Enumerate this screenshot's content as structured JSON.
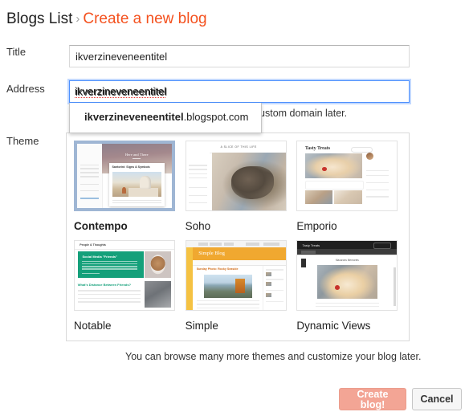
{
  "breadcrumb": {
    "parent": "Blogs List",
    "separator": "›",
    "current": "Create a new blog"
  },
  "form": {
    "title": {
      "label": "Title",
      "value": "ikverzineveneentitel"
    },
    "address": {
      "label": "Address",
      "value": "ikverzineveneentitel",
      "hint": "can also add a custom domain later.",
      "suggestion_bold": "ikverzineveneentitel",
      "suggestion_rest": ".blogspot.com"
    },
    "theme": {
      "label": "Theme",
      "footer_note": "You can browse many more themes and customize your blog later.",
      "selected": "Contempo",
      "items": [
        {
          "name": "Contempo",
          "preview_title": "Here and There",
          "preview_post": "Santorini: Signs & Symbols",
          "selected": true
        },
        {
          "name": "Soho",
          "preview_title": "A SLICE OF THIS LIFE",
          "selected": false
        },
        {
          "name": "Emporio",
          "preview_title": "Tasty Treats",
          "selected": false
        },
        {
          "name": "Notable",
          "preview_title": "People & Thoughts",
          "preview_post": "Social Media \"Friends\"",
          "preview_post2": "What's Distance Between Friends?",
          "selected": false
        },
        {
          "name": "Simple",
          "preview_title": "Simple Blog",
          "preview_post": "Sunday Photo: Rocky Seaside",
          "selected": false
        },
        {
          "name": "Dynamic Views",
          "preview_title": "Tasty Treats",
          "preview_post": "Macarons Memories",
          "selected": false
        }
      ]
    }
  },
  "actions": {
    "create_label": "Create blog!",
    "cancel_label": "Cancel"
  },
  "colors": {
    "accent_orange": "#f4511e",
    "focus_blue": "#4d90fe",
    "selected_border": "#9fb6d4",
    "create_button": "#f3a595"
  }
}
